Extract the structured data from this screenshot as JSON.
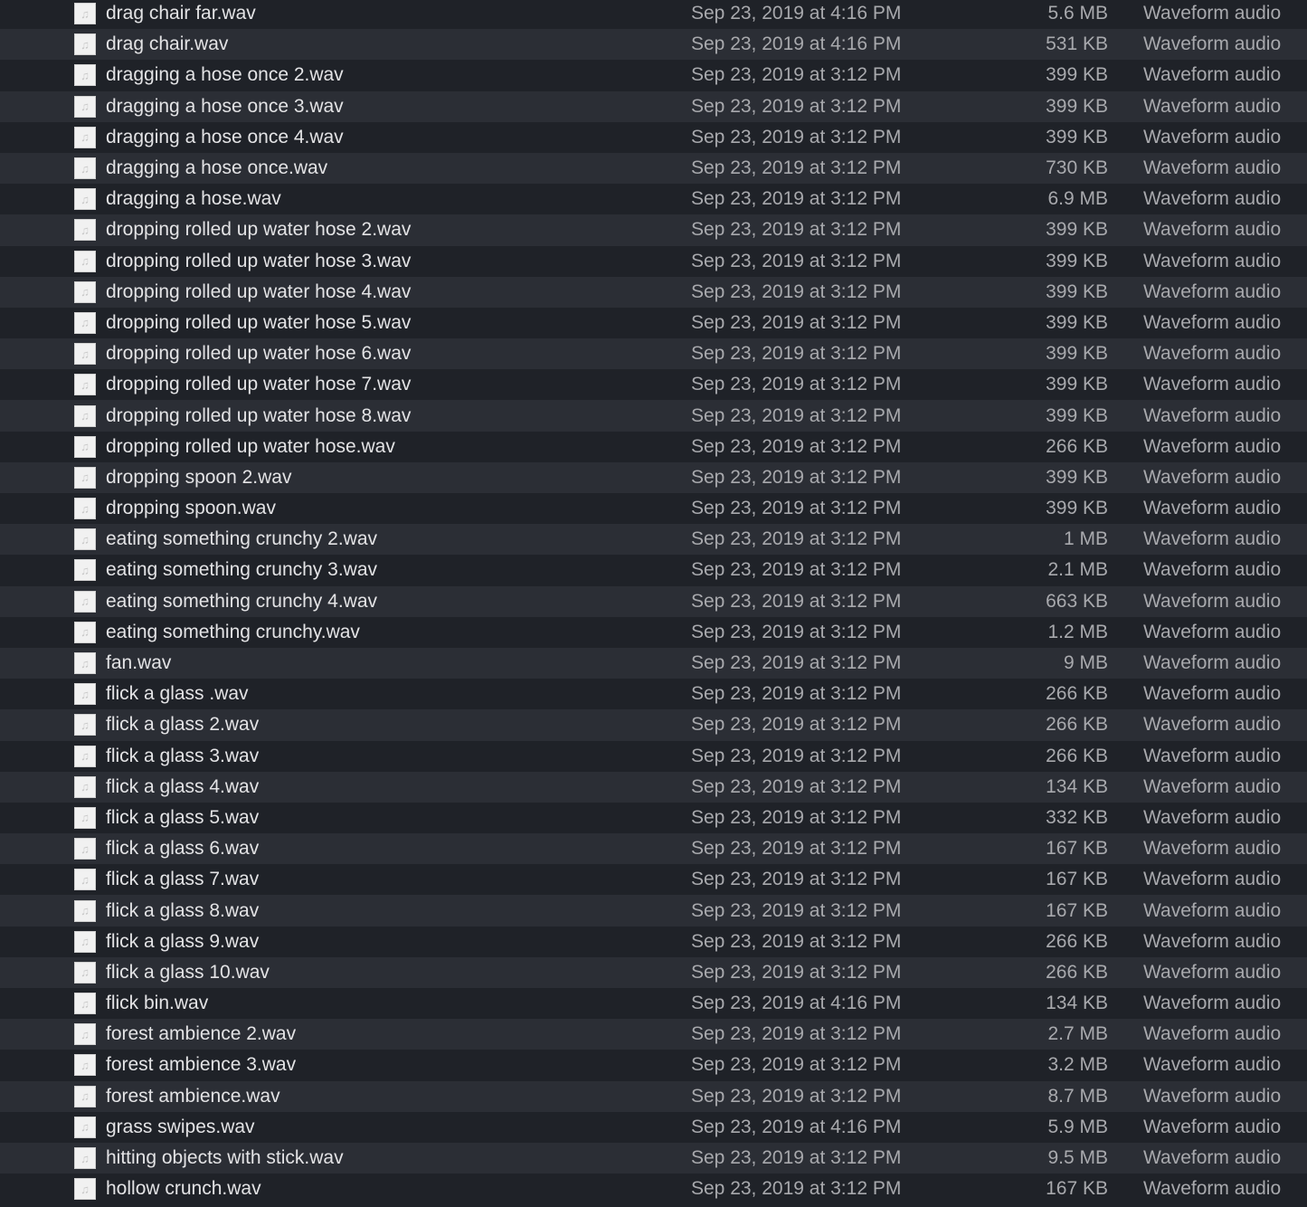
{
  "files": [
    {
      "name": "drag chair far.wav",
      "date": "Sep 23, 2019 at 4:16 PM",
      "size": "5.6 MB",
      "kind": "Waveform audio"
    },
    {
      "name": "drag chair.wav",
      "date": "Sep 23, 2019 at 4:16 PM",
      "size": "531 KB",
      "kind": "Waveform audio"
    },
    {
      "name": "dragging a hose once 2.wav",
      "date": "Sep 23, 2019 at 3:12 PM",
      "size": "399 KB",
      "kind": "Waveform audio"
    },
    {
      "name": "dragging a hose once 3.wav",
      "date": "Sep 23, 2019 at 3:12 PM",
      "size": "399 KB",
      "kind": "Waveform audio"
    },
    {
      "name": "dragging a hose once 4.wav",
      "date": "Sep 23, 2019 at 3:12 PM",
      "size": "399 KB",
      "kind": "Waveform audio"
    },
    {
      "name": "dragging a hose once.wav",
      "date": "Sep 23, 2019 at 3:12 PM",
      "size": "730 KB",
      "kind": "Waveform audio"
    },
    {
      "name": "dragging a hose.wav",
      "date": "Sep 23, 2019 at 3:12 PM",
      "size": "6.9 MB",
      "kind": "Waveform audio"
    },
    {
      "name": "dropping rolled up water hose 2.wav",
      "date": "Sep 23, 2019 at 3:12 PM",
      "size": "399 KB",
      "kind": "Waveform audio"
    },
    {
      "name": "dropping rolled up water hose 3.wav",
      "date": "Sep 23, 2019 at 3:12 PM",
      "size": "399 KB",
      "kind": "Waveform audio"
    },
    {
      "name": "dropping rolled up water hose 4.wav",
      "date": "Sep 23, 2019 at 3:12 PM",
      "size": "399 KB",
      "kind": "Waveform audio"
    },
    {
      "name": "dropping rolled up water hose 5.wav",
      "date": "Sep 23, 2019 at 3:12 PM",
      "size": "399 KB",
      "kind": "Waveform audio"
    },
    {
      "name": "dropping rolled up water hose 6.wav",
      "date": "Sep 23, 2019 at 3:12 PM",
      "size": "399 KB",
      "kind": "Waveform audio"
    },
    {
      "name": "dropping rolled up water hose 7.wav",
      "date": "Sep 23, 2019 at 3:12 PM",
      "size": "399 KB",
      "kind": "Waveform audio"
    },
    {
      "name": "dropping rolled up water hose 8.wav",
      "date": "Sep 23, 2019 at 3:12 PM",
      "size": "399 KB",
      "kind": "Waveform audio"
    },
    {
      "name": "dropping rolled up water hose.wav",
      "date": "Sep 23, 2019 at 3:12 PM",
      "size": "266 KB",
      "kind": "Waveform audio"
    },
    {
      "name": "dropping spoon 2.wav",
      "date": "Sep 23, 2019 at 3:12 PM",
      "size": "399 KB",
      "kind": "Waveform audio"
    },
    {
      "name": "dropping spoon.wav",
      "date": "Sep 23, 2019 at 3:12 PM",
      "size": "399 KB",
      "kind": "Waveform audio"
    },
    {
      "name": "eating something crunchy 2.wav",
      "date": "Sep 23, 2019 at 3:12 PM",
      "size": "1 MB",
      "kind": "Waveform audio"
    },
    {
      "name": "eating something crunchy 3.wav",
      "date": "Sep 23, 2019 at 3:12 PM",
      "size": "2.1 MB",
      "kind": "Waveform audio"
    },
    {
      "name": "eating something crunchy 4.wav",
      "date": "Sep 23, 2019 at 3:12 PM",
      "size": "663 KB",
      "kind": "Waveform audio"
    },
    {
      "name": "eating something crunchy.wav",
      "date": "Sep 23, 2019 at 3:12 PM",
      "size": "1.2 MB",
      "kind": "Waveform audio"
    },
    {
      "name": "fan.wav",
      "date": "Sep 23, 2019 at 3:12 PM",
      "size": "9 MB",
      "kind": "Waveform audio"
    },
    {
      "name": "flick a glass .wav",
      "date": "Sep 23, 2019 at 3:12 PM",
      "size": "266 KB",
      "kind": "Waveform audio"
    },
    {
      "name": "flick a glass 2.wav",
      "date": "Sep 23, 2019 at 3:12 PM",
      "size": "266 KB",
      "kind": "Waveform audio"
    },
    {
      "name": "flick a glass 3.wav",
      "date": "Sep 23, 2019 at 3:12 PM",
      "size": "266 KB",
      "kind": "Waveform audio"
    },
    {
      "name": "flick a glass 4.wav",
      "date": "Sep 23, 2019 at 3:12 PM",
      "size": "134 KB",
      "kind": "Waveform audio"
    },
    {
      "name": "flick a glass 5.wav",
      "date": "Sep 23, 2019 at 3:12 PM",
      "size": "332 KB",
      "kind": "Waveform audio"
    },
    {
      "name": "flick a glass 6.wav",
      "date": "Sep 23, 2019 at 3:12 PM",
      "size": "167 KB",
      "kind": "Waveform audio"
    },
    {
      "name": "flick a glass 7.wav",
      "date": "Sep 23, 2019 at 3:12 PM",
      "size": "167 KB",
      "kind": "Waveform audio"
    },
    {
      "name": "flick a glass 8.wav",
      "date": "Sep 23, 2019 at 3:12 PM",
      "size": "167 KB",
      "kind": "Waveform audio"
    },
    {
      "name": "flick a glass 9.wav",
      "date": "Sep 23, 2019 at 3:12 PM",
      "size": "266 KB",
      "kind": "Waveform audio"
    },
    {
      "name": "flick a glass 10.wav",
      "date": "Sep 23, 2019 at 3:12 PM",
      "size": "266 KB",
      "kind": "Waveform audio"
    },
    {
      "name": "flick bin.wav",
      "date": "Sep 23, 2019 at 4:16 PM",
      "size": "134 KB",
      "kind": "Waveform audio"
    },
    {
      "name": "forest ambience 2.wav",
      "date": "Sep 23, 2019 at 3:12 PM",
      "size": "2.7 MB",
      "kind": "Waveform audio"
    },
    {
      "name": "forest ambience 3.wav",
      "date": "Sep 23, 2019 at 3:12 PM",
      "size": "3.2 MB",
      "kind": "Waveform audio"
    },
    {
      "name": "forest ambience.wav",
      "date": "Sep 23, 2019 at 3:12 PM",
      "size": "8.7 MB",
      "kind": "Waveform audio"
    },
    {
      "name": "grass swipes.wav",
      "date": "Sep 23, 2019 at 4:16 PM",
      "size": "5.9 MB",
      "kind": "Waveform audio"
    },
    {
      "name": "hitting objects with stick.wav",
      "date": "Sep 23, 2019 at 3:12 PM",
      "size": "9.5 MB",
      "kind": "Waveform audio"
    },
    {
      "name": "hollow crunch.wav",
      "date": "Sep 23, 2019 at 3:12 PM",
      "size": "167 KB",
      "kind": "Waveform audio"
    }
  ],
  "icon": {
    "name": "audio-file-icon",
    "glyph": "♫"
  }
}
